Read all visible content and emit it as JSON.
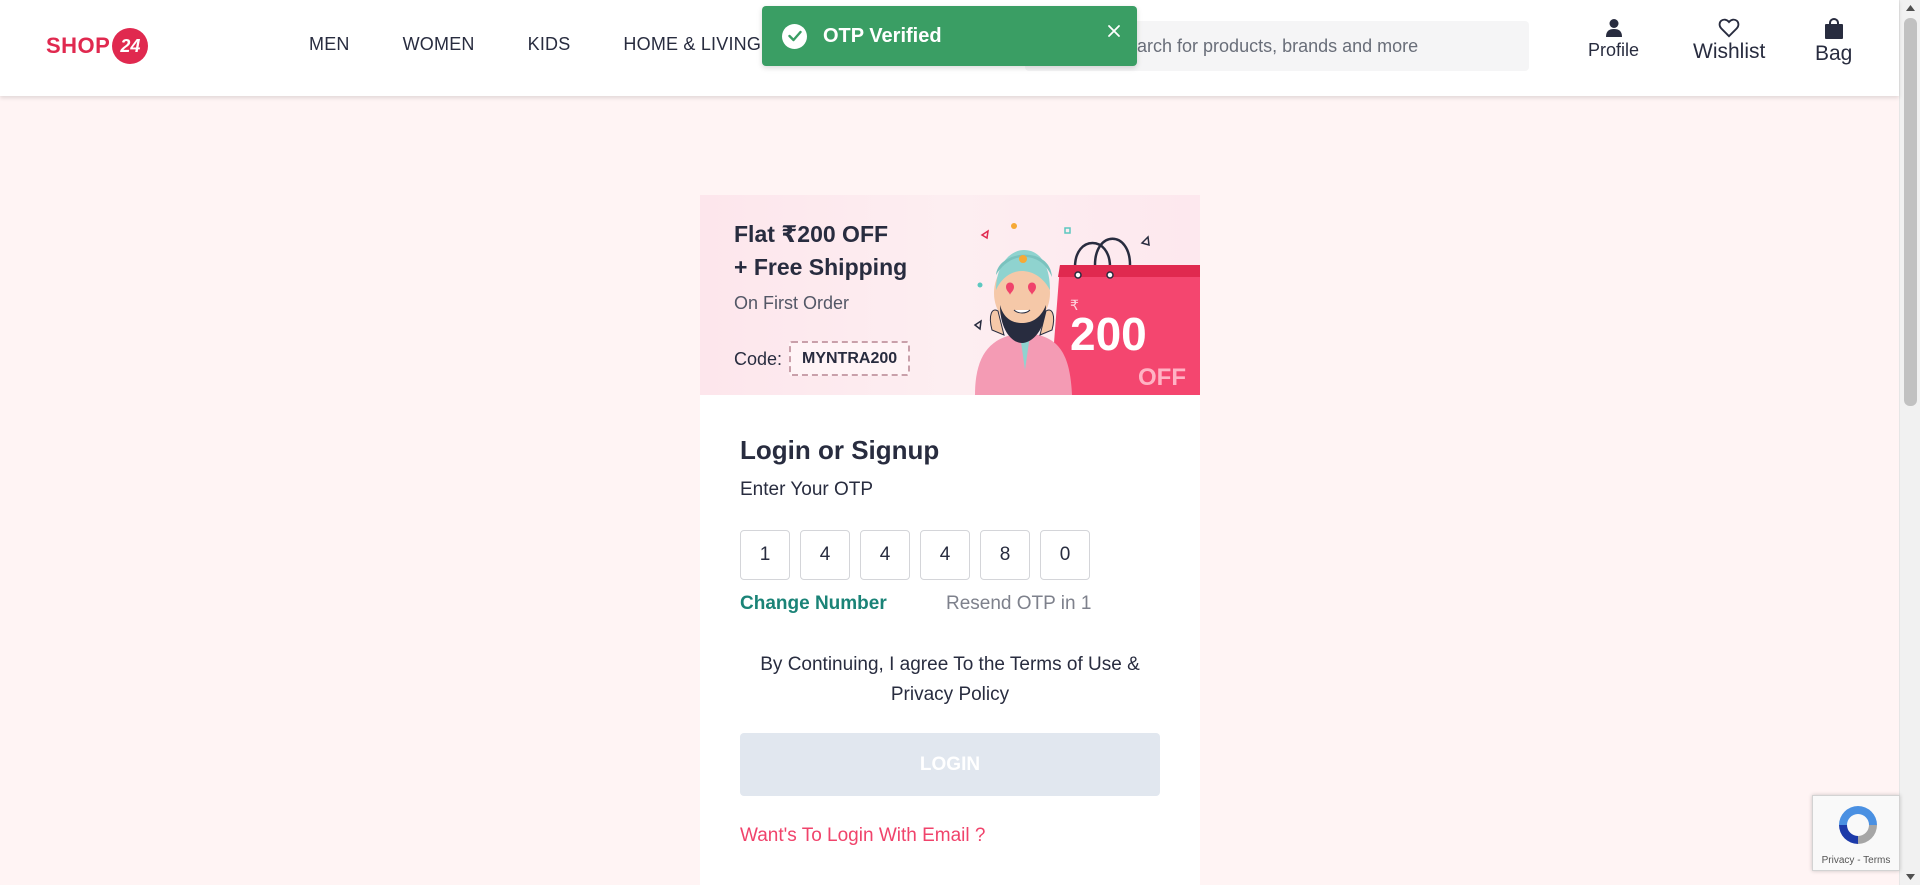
{
  "header": {
    "logo_text": "SHOP",
    "logo_badge": "24",
    "nav": [
      "MEN",
      "WOMEN",
      "KIDS",
      "HOME & LIVING"
    ],
    "search_placeholder": "Search for products, brands and more",
    "actions": {
      "profile": "Profile",
      "wishlist": "Wishlist",
      "bag": "Bag"
    }
  },
  "toast": {
    "message": "OTP Verified",
    "color": "#3a9e64"
  },
  "banner": {
    "line1": "Flat ₹200 OFF",
    "line2": "+ Free Shipping",
    "sub": "On First Order",
    "code_label": "Code:",
    "code": "MYNTRA200",
    "art_amount": "200",
    "art_off": "OFF",
    "art_currency": "₹"
  },
  "login": {
    "title": "Login or Signup",
    "subtitle": "Enter Your OTP",
    "otp": [
      "1",
      "4",
      "4",
      "4",
      "8",
      "0"
    ],
    "change_number": "Change Number",
    "resend": "Resend OTP in 1",
    "terms": "By Continuing, I agree To the Terms of Use & Privacy Policy",
    "login_button": "LOGIN",
    "email_link": "Want's To Login With Email ?"
  },
  "recaptcha": {
    "text": "Privacy - Terms"
  },
  "colors": {
    "brand": "#e0294f",
    "teal": "#1a8377",
    "link_pink": "#f0436b",
    "page_bg": "#fff4f4"
  }
}
